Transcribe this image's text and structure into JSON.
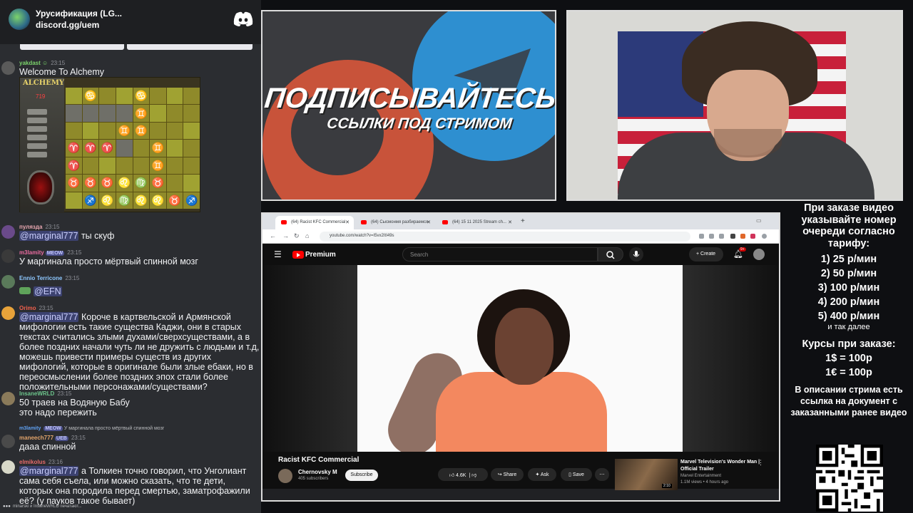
{
  "discord": {
    "server_name": "Урусификация (LG...",
    "invite": "discord.gg/uem",
    "messages": [
      {
        "user": "yakdast",
        "user_color": "#7bd36b",
        "time": "23:15",
        "text": "Welcome To Alchemy"
      },
      {
        "user": "пуляздa",
        "user_color": "#e7a6b0",
        "time": "23:15",
        "mention": "@marginal777",
        "text": " ты скуф"
      },
      {
        "user": "m3lamity",
        "badge": "MEOW",
        "user_color": "#e86b9f",
        "time": "23:15",
        "text": "У маргинала просто мёртвый спинной мозг"
      },
      {
        "user": "Ennio Terricone",
        "user_color": "#8ec8ff",
        "time": "23:15",
        "mention": "@EFN",
        "text": ""
      },
      {
        "user": "Orimo",
        "user_color": "#f0604c",
        "time": "23:15",
        "mention": "@marginal777",
        "text": " Короче в картвельской и Армянской мифологии есть такие существа Каджи, они в старых текстах считались злыми духами/сверхсуществами, а в более поздних начали чуть ли не дружить с людьми и т.д, можешь привести примеры существ из других мифологий, которые в оригинале были злые ебаки, но в переосмыслении более поздних эпох стали более положительными персонажами/существами?"
      },
      {
        "user": "InsaneWRLD",
        "user_color": "#6cc48b",
        "time": "23:15",
        "text": "50 траев на Водяную Бабу\nэто надо пережить"
      },
      {
        "user": "maneech777",
        "badge": "UEB",
        "user_color": "#e0a36a",
        "time": "23:15",
        "reply_user": "m3lamity",
        "reply_badge": "MEOW",
        "reply_text": "У маргинала просто мёртвый спинной мозг",
        "text": "дааа спинной"
      },
      {
        "user": "elmikolus",
        "user_color": "#e86b6b",
        "time": "23:16",
        "mention": "@marginal777",
        "text": " а Толкиен точно говорил, что Унголиант сама себя съела, или можно сказать, что те дети, которых она породила перед смертью, заматрофажили её? (у пауков такое бывает)"
      }
    ],
    "typing": "minarski и InsaneWRLD печатают..."
  },
  "alchemy": {
    "title": "ALCHEMY",
    "score": "719",
    "board": [
      [
        "",
        "♋",
        "",
        "",
        "♋",
        "",
        "",
        ""
      ],
      [
        "g",
        "g",
        "g",
        "g",
        "♊",
        "",
        "",
        ""
      ],
      [
        "",
        "",
        "",
        "♊",
        "♊",
        "",
        "",
        ""
      ],
      [
        "♈",
        "♈",
        "♈",
        "g",
        "",
        "♊",
        "",
        ""
      ],
      [
        "♈",
        "",
        "",
        "",
        "",
        "♊",
        "",
        ""
      ],
      [
        "♉",
        "♉",
        "♉",
        "♌",
        "♍",
        "♉",
        "",
        ""
      ],
      [
        "",
        "♐",
        "♌",
        "♍",
        "♌",
        "♌",
        "♉",
        "♐"
      ]
    ]
  },
  "promo": {
    "line1": "ПОДПИСЫВАЙТЕСЬ",
    "line2": "ССЫЛКИ ПОД СТРИМОМ"
  },
  "browser": {
    "tabs": [
      {
        "label": "(64) Racist KFC Commercial",
        "active": true
      },
      {
        "label": "(64) Сысмонмя разбираемся",
        "active": false
      },
      {
        "label": "(64) 15 11 2025 Stream ch...",
        "active": false
      }
    ],
    "url": "youtube.com/watch?v=I5vx2ItI49s",
    "youtube": {
      "brand": "Premium",
      "search_placeholder": "Search",
      "create_label": "Create",
      "notif_count": "9+",
      "video_title": "Racist KFC Commercial",
      "channel_name": "Chernovsky M",
      "channel_subs": "405 subscribers",
      "subscribe_label": "Subscribe",
      "likes": "4.6K",
      "share_label": "Share",
      "ask_label": "Ask",
      "save_label": "Save",
      "related": {
        "title": "Marvel Television's Wonder Man | Official Trailer",
        "channel": "Marvel Entertainment",
        "meta": "1.1M views • 4 hours ago",
        "duration": "2:10"
      }
    }
  },
  "info": {
    "order_text": "При заказе видео указывайте номер очереди согласно тарифу:",
    "prices": [
      "1) 25 р/мин",
      "2) 50 р/мин",
      "3) 100 р/мин",
      "4) 200 р/мин",
      "5) 400 р/мин"
    ],
    "more": "и так далее",
    "rates_title": "Курсы при заказе:",
    "rates": [
      "1$ = 100р",
      "1€ = 100р"
    ],
    "description": "В описании стрима есть ссылка на документ с заказанными ранее видео"
  }
}
